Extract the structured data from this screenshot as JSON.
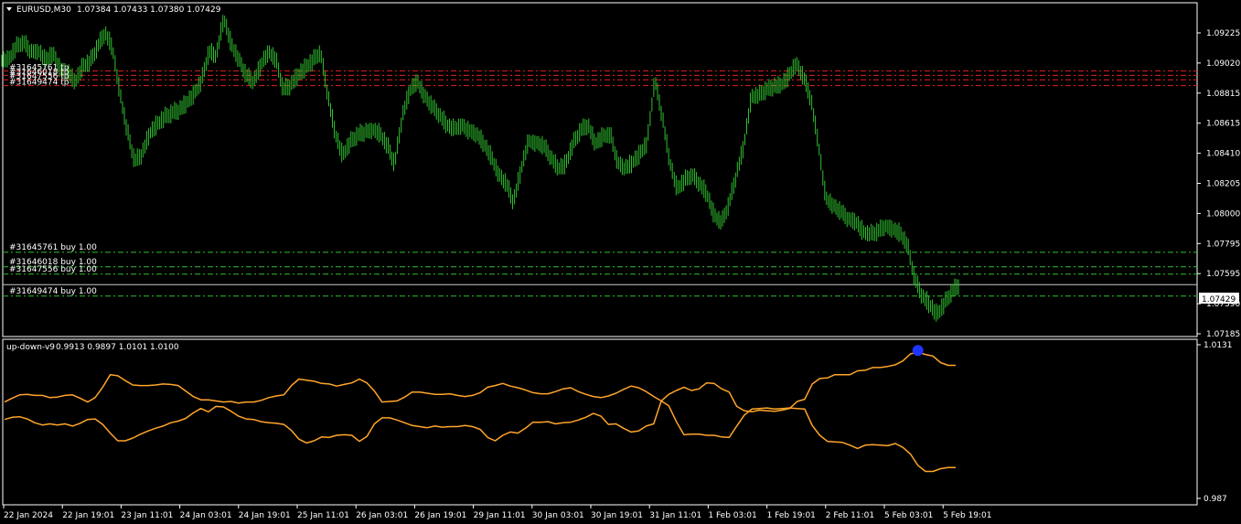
{
  "main_header": {
    "symbol": "EURUSD,M30",
    "ohlc": "1.07384 1.07433 1.07380 1.07429"
  },
  "indicator_header": {
    "name": "up-down-v9",
    "values": "0.9913 0.9897 1.0101 1.0100"
  },
  "current_price_label": "1.07429",
  "colors": {
    "background": "#000000",
    "price_line": "#2fbf2f",
    "indicator_line": "#ffa52a",
    "sl_line": "#e02020",
    "order_line": "#2fbf2f",
    "signal_dot": "#1f35ff",
    "current_price": "#c8c8c8",
    "frame": "#ffffff"
  },
  "chart_data": [
    {
      "type": "line",
      "panel": "price",
      "title": "EURUSD,M30",
      "ylim": [
        1.0708,
        1.0935
      ],
      "y_ticks": [
        "1.09225",
        "1.09020",
        "1.08815",
        "1.08615",
        "1.08410",
        "1.08205",
        "1.08000",
        "1.07795",
        "1.07595",
        "1.07390",
        "1.07185"
      ],
      "x_ticks": [
        "22 Jan 2024",
        "22 Jan 19:01",
        "23 Jan 11:01",
        "24 Jan 03:01",
        "24 Jan 19:01",
        "25 Jan 11:01",
        "26 Jan 03:01",
        "26 Jan 19:01",
        "29 Jan 11:01",
        "30 Jan 03:01",
        "30 Jan 19:01",
        "31 Jan 11:01",
        "1 Feb 03:01",
        "1 Feb 19:01",
        "2 Feb 11:01",
        "5 Feb 03:01",
        "5 Feb 19:01"
      ],
      "series": [
        {
          "values": [
            1.0896,
            1.0905,
            1.0909,
            1.0902,
            1.0903,
            1.0896,
            1.0901,
            1.089,
            1.0888,
            1.0881,
            1.0892,
            1.0895,
            1.0905,
            1.0915,
            1.0905,
            1.0874,
            1.0848,
            1.0827,
            1.0832,
            1.0846,
            1.0852,
            1.0857,
            1.086,
            1.0862,
            1.0867,
            1.0873,
            1.0882,
            1.0902,
            1.0899,
            1.0925,
            1.0907,
            1.0897,
            1.0886,
            1.0881,
            1.0893,
            1.0902,
            1.0897,
            1.0876,
            1.0879,
            1.0886,
            1.0891,
            1.0896,
            1.0902,
            1.0872,
            1.0846,
            1.0831,
            1.084,
            1.0845,
            1.0847,
            1.0849,
            1.0846,
            1.0838,
            1.0825,
            1.0857,
            1.0875,
            1.0882,
            1.0872,
            1.0865,
            1.0859,
            1.0852,
            1.0849,
            1.0852,
            1.0848,
            1.0846,
            1.0839,
            1.083,
            1.0818,
            1.0812,
            1.0799,
            1.0821,
            1.0841,
            1.084,
            1.0838,
            1.083,
            1.0822,
            1.0825,
            1.0839,
            1.0848,
            1.0852,
            1.0839,
            1.0844,
            1.0846,
            1.0826,
            1.0822,
            1.0826,
            1.0832,
            1.084,
            1.0883,
            1.0858,
            1.0827,
            1.0808,
            1.0814,
            1.0818,
            1.0812,
            1.0805,
            1.079,
            1.0785,
            1.0798,
            1.0818,
            1.0838,
            1.0871,
            1.0872,
            1.0876,
            1.0878,
            1.0879,
            1.0885,
            1.0894,
            1.0885,
            1.087,
            1.084,
            1.0802,
            1.0797,
            1.0793,
            1.0788,
            1.0786,
            1.0779,
            1.0777,
            1.0779,
            1.0783,
            1.0781,
            1.0778,
            1.077,
            1.0746,
            1.0735,
            1.0729,
            1.0722,
            1.073,
            1.0738,
            1.0743
          ]
        }
      ]
    },
    {
      "type": "line",
      "panel": "indicator",
      "title": "up-down-v9",
      "ylim": [
        0.987,
        1.0131
      ],
      "y_ticks": [
        "1.0131",
        "0.987"
      ],
      "series": [
        {
          "values": [
            1.0033,
            1.004,
            1.0046,
            1.0047,
            1.0045,
            1.0045,
            1.0041,
            1.0042,
            1.0045,
            1.0046,
            1.004,
            1.0033,
            1.0041,
            1.006,
            1.0083,
            1.0081,
            1.0072,
            1.0064,
            1.0063,
            1.0063,
            1.0064,
            1.0066,
            1.0065,
            1.0063,
            1.0053,
            1.0043,
            1.0037,
            1.0037,
            1.0035,
            1.0033,
            1.0034,
            1.0031,
            1.0033,
            1.0033,
            1.0036,
            1.0041,
            1.0044,
            1.0046,
            1.0063,
            1.0075,
            1.0073,
            1.0071,
            1.0067,
            1.0066,
            1.0062,
            1.0065,
            1.0068,
            1.0075,
            1.0068,
            1.0053,
            1.0033,
            1.0034,
            1.0035,
            1.0042,
            1.0051,
            1.0051,
            1.0049,
            1.0047,
            1.0047,
            1.0048,
            1.0045,
            1.0043,
            1.0045,
            1.005,
            1.006,
            1.0063,
            1.0067,
            1.0062,
            1.0059,
            1.0055,
            1.005,
            1.0048,
            1.0048,
            1.0052,
            1.0057,
            1.0059,
            1.0052,
            1.0047,
            1.0043,
            1.0041,
            1.0044,
            1.0049,
            1.0056,
            1.0062,
            1.0059,
            1.0052,
            1.0043,
            1.0035,
            1.0047,
            1.0054,
            1.006,
            1.0054,
            1.0057,
            1.0068,
            1.0067,
            1.0057,
            1.0051,
            1.0025,
            1.0017,
            1.0015,
            1.0018,
            1.0017,
            1.0016,
            1.0018,
            1.0021,
            1.0034,
            1.0038,
            1.0066,
            1.0076,
            1.0077,
            1.0083,
            1.0083,
            1.0083,
            1.009,
            1.0091,
            1.0096,
            1.0096,
            1.0098,
            1.0101,
            1.0108,
            1.0121,
            1.0124,
            1.012,
            1.0117,
            1.0105,
            1.01,
            1.01
          ]
        },
        {
          "values": [
            1.0001,
            1.0005,
            1.0006,
            1.0002,
            0.9995,
            0.9991,
            0.9993,
            0.9991,
            0.9993,
            0.9989,
            0.9994,
            1.0001,
            1.0002,
            0.9992,
            0.9976,
            0.9962,
            0.9962,
            0.9967,
            0.9974,
            0.998,
            0.9985,
            0.9989,
            0.9995,
            0.9998,
            1.0003,
            1.0013,
            1.0021,
            1.0015,
            1.0025,
            1.0024,
            1.0016,
            1.0007,
            1.0002,
            1.0001,
            0.9997,
            0.9995,
            0.9994,
            0.9992,
            0.9981,
            0.9965,
            0.9958,
            0.9962,
            0.9969,
            0.9968,
            0.9972,
            0.9973,
            0.9972,
            0.9961,
            0.997,
            0.9993,
            1.0004,
            1.0004,
            1.0,
            0.9995,
            0.999,
            0.9988,
            0.9986,
            0.9989,
            0.9987,
            0.9988,
            0.9988,
            0.999,
            0.9988,
            0.9983,
            0.9968,
            0.9962,
            0.9972,
            0.9978,
            0.9976,
            0.9985,
            0.9996,
            0.9996,
            0.9997,
            0.9993,
            0.9995,
            0.9996,
            1.0,
            1.0005,
            1.0012,
            1.0007,
            0.9992,
            0.9993,
            0.9985,
            0.9978,
            0.998,
            0.9989,
            0.9993,
            1.0035,
            1.0026,
            0.9997,
            0.9973,
            0.9974,
            0.9974,
            0.9972,
            0.9972,
            0.9969,
            0.9968,
            0.9989,
            1.0009,
            1.002,
            1.0021,
            1.0022,
            1.002,
            1.0021,
            1.0022,
            1.0021,
            1.002,
            0.999,
            0.9972,
            0.9961,
            0.996,
            0.9959,
            0.9954,
            0.9948,
            0.9954,
            0.9955,
            0.9954,
            0.9953,
            0.9957,
            0.995,
            0.9938,
            0.9917,
            0.9906,
            0.9906,
            0.9911,
            0.9913,
            0.9913
          ]
        }
      ],
      "signal_marker": "up"
    }
  ],
  "order_labels": {
    "tp": [
      "#31645761 tp",
      "#31646018 tp",
      "#31647556 tp",
      "#31649474 tp"
    ],
    "buy": [
      "#31645761 buy 1.00",
      "#31646018 buy 1.00",
      "#31647556 buy 1.00",
      "#31649474 buy 1.00"
    ]
  },
  "order_levels": {
    "tp": [
      1.0889,
      1.0886,
      1.0883,
      1.0879
    ],
    "buy": [
      1.0765,
      1.0755,
      1.075,
      1.0735
    ]
  }
}
